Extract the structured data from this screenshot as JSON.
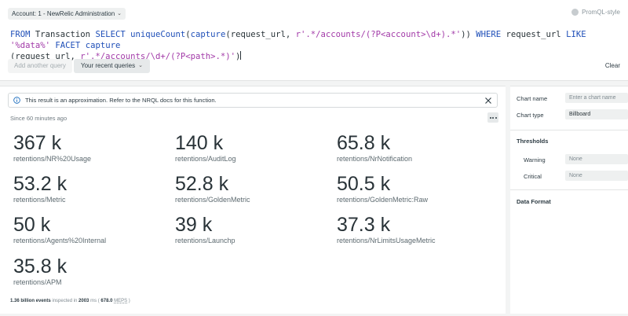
{
  "header": {
    "account_label": "Account: 1 - NewRelic Administration",
    "promql_label": "PromQL-style"
  },
  "query": {
    "parts": [
      {
        "text": "FROM",
        "kind": "kw"
      },
      {
        "text": " Transaction ",
        "kind": "plain"
      },
      {
        "text": "SELECT",
        "kind": "kw"
      },
      {
        "text": " ",
        "kind": "plain"
      },
      {
        "text": "uniqueCount",
        "kind": "kw"
      },
      {
        "text": "(",
        "kind": "plain"
      },
      {
        "text": "capture",
        "kind": "kw"
      },
      {
        "text": "(request_url, ",
        "kind": "plain"
      },
      {
        "text": "r'.*/accounts/(?P<account>\\d+).*'",
        "kind": "str"
      },
      {
        "text": ")) ",
        "kind": "plain"
      },
      {
        "text": "WHERE",
        "kind": "kw"
      },
      {
        "text": " request_url ",
        "kind": "plain"
      },
      {
        "text": "LIKE",
        "kind": "kw"
      },
      {
        "text": " ",
        "kind": "plain"
      },
      {
        "text": "'%data%'",
        "kind": "str"
      },
      {
        "text": " ",
        "kind": "plain"
      },
      {
        "text": "FACET",
        "kind": "kw"
      },
      {
        "text": " ",
        "kind": "plain"
      },
      {
        "text": "capture",
        "kind": "kw"
      },
      {
        "text": "\n(request_url, ",
        "kind": "plain"
      },
      {
        "text": "r'.*/accounts/\\d+/(?P<path>.*)'",
        "kind": "str"
      },
      {
        "text": ")",
        "kind": "plain"
      }
    ]
  },
  "toolbar": {
    "add_query_label": "Add another query",
    "recent_queries_label": "Your recent queries",
    "clear_label": "Clear"
  },
  "results": {
    "notice": "This result is an approximation. Refer to the NRQL docs for this function.",
    "since": "Since 60 minutes ago",
    "metrics": [
      {
        "value": "367 k",
        "label": "retentions/NR%20Usage"
      },
      {
        "value": "140 k",
        "label": "retentions/AuditLog"
      },
      {
        "value": "65.8 k",
        "label": "retentions/NrNotification"
      },
      {
        "value": "53.2 k",
        "label": "retentions/Metric"
      },
      {
        "value": "52.8 k",
        "label": "retentions/GoldenMetric"
      },
      {
        "value": "50.5 k",
        "label": "retentions/GoldenMetric:Raw"
      },
      {
        "value": "50 k",
        "label": "retentions/Agents%20Internal"
      },
      {
        "value": "39 k",
        "label": "retentions/Launchp"
      },
      {
        "value": "37.3 k",
        "label": "retentions/NrLimitsUsageMetric"
      },
      {
        "value": "35.8 k",
        "label": "retentions/APM"
      }
    ],
    "footer": {
      "events": "1.36 billion events",
      "inspected_in": " inspected in ",
      "ms": "2003",
      "ms_unit": " ms ( ",
      "rate": "678.0",
      "meps": "MEPS",
      "close": " )"
    }
  },
  "side_panel": {
    "chart_name_label": "Chart name",
    "chart_name_placeholder": "Enter a chart name",
    "chart_type_label": "Chart type",
    "chart_type_value": "Billboard",
    "thresholds_title": "Thresholds",
    "warning_label": "Warning",
    "warning_value": "None",
    "critical_label": "Critical",
    "critical_value": "None",
    "data_format_title": "Data Format"
  },
  "colors": {
    "keyword": "#1f4fb8",
    "string": "#a23aa8",
    "info_icon": "#1f6fbf"
  }
}
